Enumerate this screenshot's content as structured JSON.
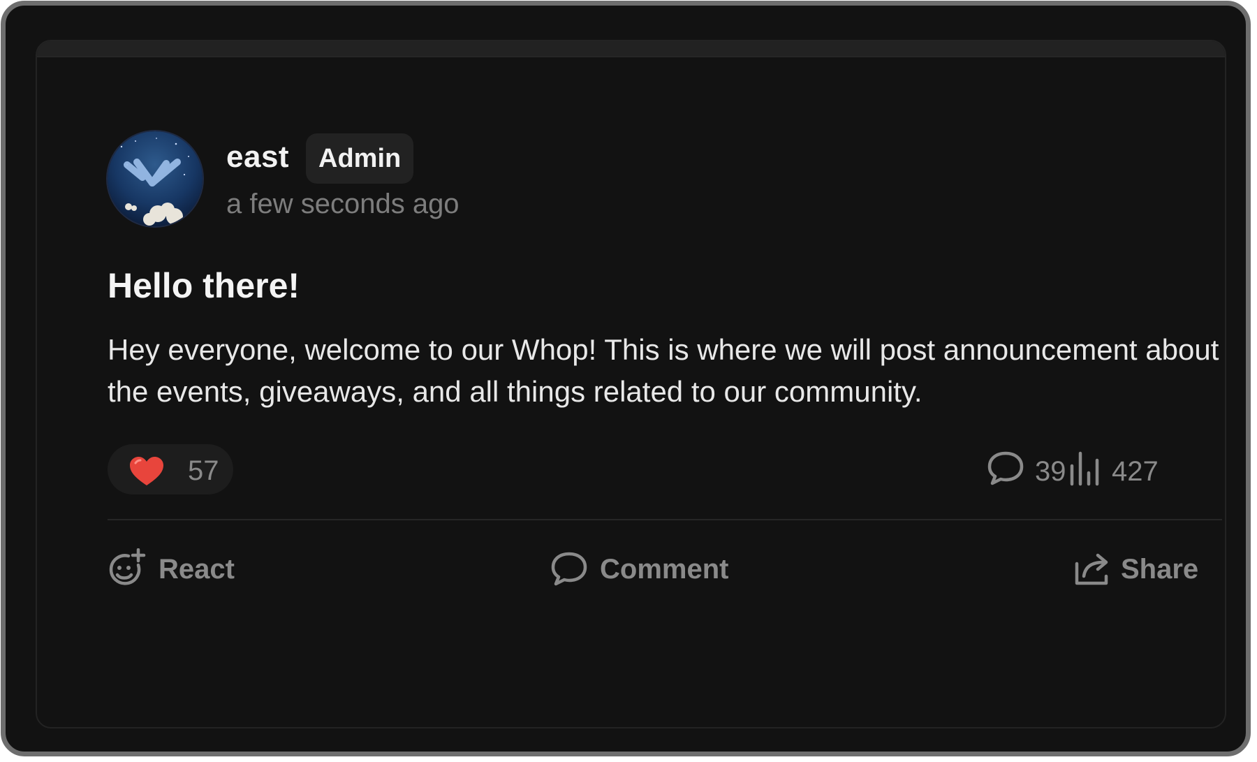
{
  "post": {
    "author": {
      "name": "east",
      "role_badge": "Admin",
      "timestamp": "a few seconds ago",
      "avatar_icon": "whop-logo-night-sky-avatar"
    },
    "title": "Hello there!",
    "body": "Hey everyone, welcome to our Whop! This is where we will post announcement about the events, giveaways, and all things related to our community.",
    "reaction": {
      "icon": "heart-icon",
      "count": "57",
      "color": "#e8453c"
    },
    "stats": {
      "comments": {
        "icon": "comment-icon",
        "count": "39"
      },
      "views": {
        "icon": "bar-chart-icon",
        "count": "427"
      }
    },
    "actions": {
      "react": {
        "icon": "add-emoji-icon",
        "label": "React"
      },
      "comment": {
        "icon": "comment-icon",
        "label": "Comment"
      },
      "share": {
        "icon": "share-icon",
        "label": "Share"
      }
    }
  },
  "colors": {
    "background": "#121212",
    "text_primary": "#f2f2f2",
    "text_muted": "#8a8a8a",
    "pill_background": "#1d1d1d",
    "heart": "#e8453c"
  }
}
